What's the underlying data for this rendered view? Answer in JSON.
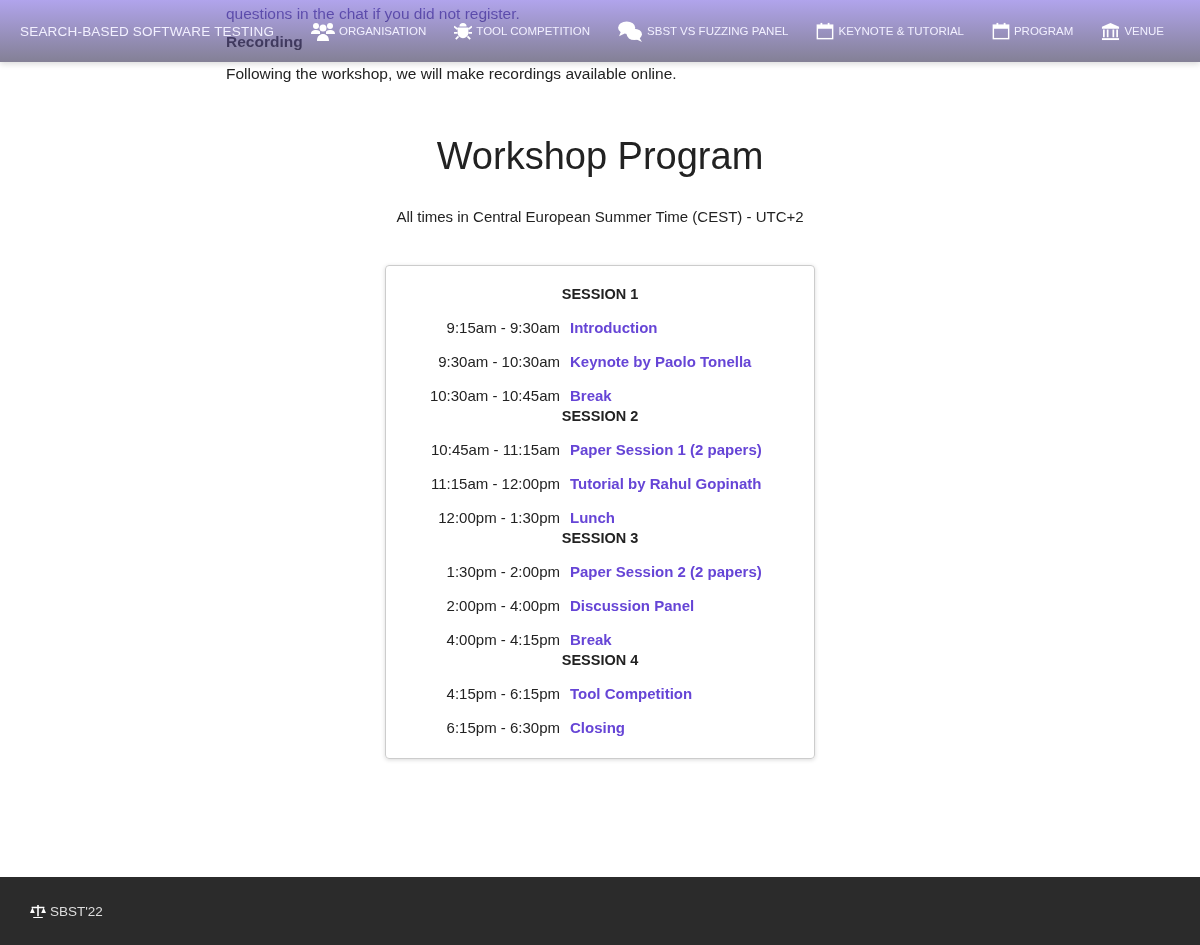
{
  "site_title": "SEARCH-BASED SOFTWARE TESTING",
  "nav": [
    {
      "label": "ORGANISATION"
    },
    {
      "label": "TOOL COMPETITION"
    },
    {
      "label": "SBST VS FUZZING PANEL"
    },
    {
      "label": "KEYNOTE & TUTORIAL"
    },
    {
      "label": "PROGRAM"
    },
    {
      "label": "VENUE"
    }
  ],
  "intro": {
    "partial_line": "questions in the chat if you did not register.",
    "heading": "Recording",
    "text": "Following the workshop, we will make recordings available online."
  },
  "program": {
    "title": "Workshop Program",
    "timezone": "All times in Central European Summer Time (CEST) - UTC+2",
    "sessions": [
      {
        "name": "SESSION 1",
        "slots": [
          {
            "time": "9:15am - 9:30am",
            "title": "Introduction"
          },
          {
            "time": "9:30am - 10:30am",
            "title": "Keynote by Paolo Tonella"
          },
          {
            "time": "10:30am - 10:45am",
            "title": "Break"
          }
        ]
      },
      {
        "name": "SESSION 2",
        "slots": [
          {
            "time": "10:45am - 11:15am",
            "title": "Paper Session 1 (2 papers)"
          },
          {
            "time": "11:15am - 12:00pm",
            "title": "Tutorial by Rahul Gopinath"
          },
          {
            "time": "12:00pm - 1:30pm",
            "title": "Lunch"
          }
        ]
      },
      {
        "name": "SESSION 3",
        "slots": [
          {
            "time": "1:30pm - 2:00pm",
            "title": "Paper Session 2 (2 papers)"
          },
          {
            "time": "2:00pm - 4:00pm",
            "title": "Discussion Panel"
          },
          {
            "time": "4:00pm - 4:15pm",
            "title": "Break"
          }
        ]
      },
      {
        "name": "SESSION 4",
        "slots": [
          {
            "time": "4:15pm - 6:15pm",
            "title": "Tool Competition"
          },
          {
            "time": "6:15pm - 6:30pm",
            "title": "Closing"
          }
        ]
      }
    ]
  },
  "footer": {
    "text": "SBST'22"
  }
}
